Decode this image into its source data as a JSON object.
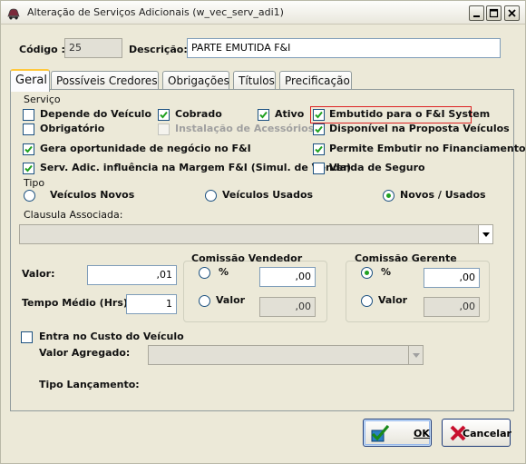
{
  "window": {
    "title": "Alteração de Serviços Adicionais (w_vec_serv_adi1)"
  },
  "header": {
    "codigo_label": "Código :",
    "codigo_value": "25",
    "descricao_label": "Descrição:",
    "descricao_value": "PARTE EMUTIDA F&I"
  },
  "tabs": [
    {
      "label": "Geral",
      "active": true
    },
    {
      "label": "Possíveis Credores",
      "active": false
    },
    {
      "label": "Obrigações",
      "active": false
    },
    {
      "label": "Títulos",
      "active": false
    },
    {
      "label": "Precificação",
      "active": false
    }
  ],
  "servico": {
    "title": "Serviço",
    "depende_veiculo": {
      "label": "Depende do Veículo",
      "checked": false
    },
    "cobrado": {
      "label": "Cobrado",
      "checked": true
    },
    "ativo": {
      "label": "Ativo",
      "checked": true
    },
    "embutido": {
      "label": "Embutido para o F&I System",
      "checked": true
    },
    "obrigatorio": {
      "label": "Obrigatório",
      "checked": false
    },
    "instalacao": {
      "label": "Instalação de Acessórios",
      "checked": false,
      "disabled": true
    },
    "disponivel": {
      "label": "Disponível na Proposta Veículos",
      "checked": true
    },
    "gera_oportunidade": {
      "label": "Gera oportunidade de negócio no F&I",
      "checked": true
    },
    "permite_embutir": {
      "label": "Permite Embutir no Financiamento",
      "checked": true
    },
    "serv_adic": {
      "label": "Serv. Adic. influência na Margem F&I (Simul. de Venda)",
      "checked": true
    },
    "venda_seguro": {
      "label": "Venda de Seguro",
      "checked": false
    }
  },
  "tipo": {
    "title": "Tipo",
    "options": [
      {
        "label": "Veículos Novos",
        "selected": false
      },
      {
        "label": "Veículos Usados",
        "selected": false
      },
      {
        "label": "Novos / Usados",
        "selected": true
      }
    ]
  },
  "clausula": {
    "label": "Clausula Associada:",
    "value": ""
  },
  "valor": {
    "label": "Valor:",
    "value": ",01"
  },
  "tempo_medio": {
    "label": "Tempo Médio (Hrs):",
    "value": "1"
  },
  "comissao_vendedor": {
    "title": "Comissão Vendedor",
    "percent_label": "%",
    "percent_selected": false,
    "percent_value": ",00",
    "valor_label": "Valor",
    "valor_selected": false,
    "valor_value": ",00"
  },
  "comissao_gerente": {
    "title": "Comissão Gerente",
    "percent_label": "%",
    "percent_selected": true,
    "percent_value": ",00",
    "valor_label": "Valor",
    "valor_selected": false,
    "valor_value": ",00"
  },
  "custo_veiculo": {
    "label": "Entra no Custo do Veículo",
    "checked": false
  },
  "valor_agregado": {
    "label": "Valor Agregado:",
    "value": ""
  },
  "tipo_lancamento": {
    "label": "Tipo Lançamento:"
  },
  "buttons": {
    "ok": "OK",
    "cancelar": "Cancelar"
  },
  "colors": {
    "highlight": "#dd2222",
    "check": "#21a121",
    "tab_active_border": "#ffc83c"
  }
}
